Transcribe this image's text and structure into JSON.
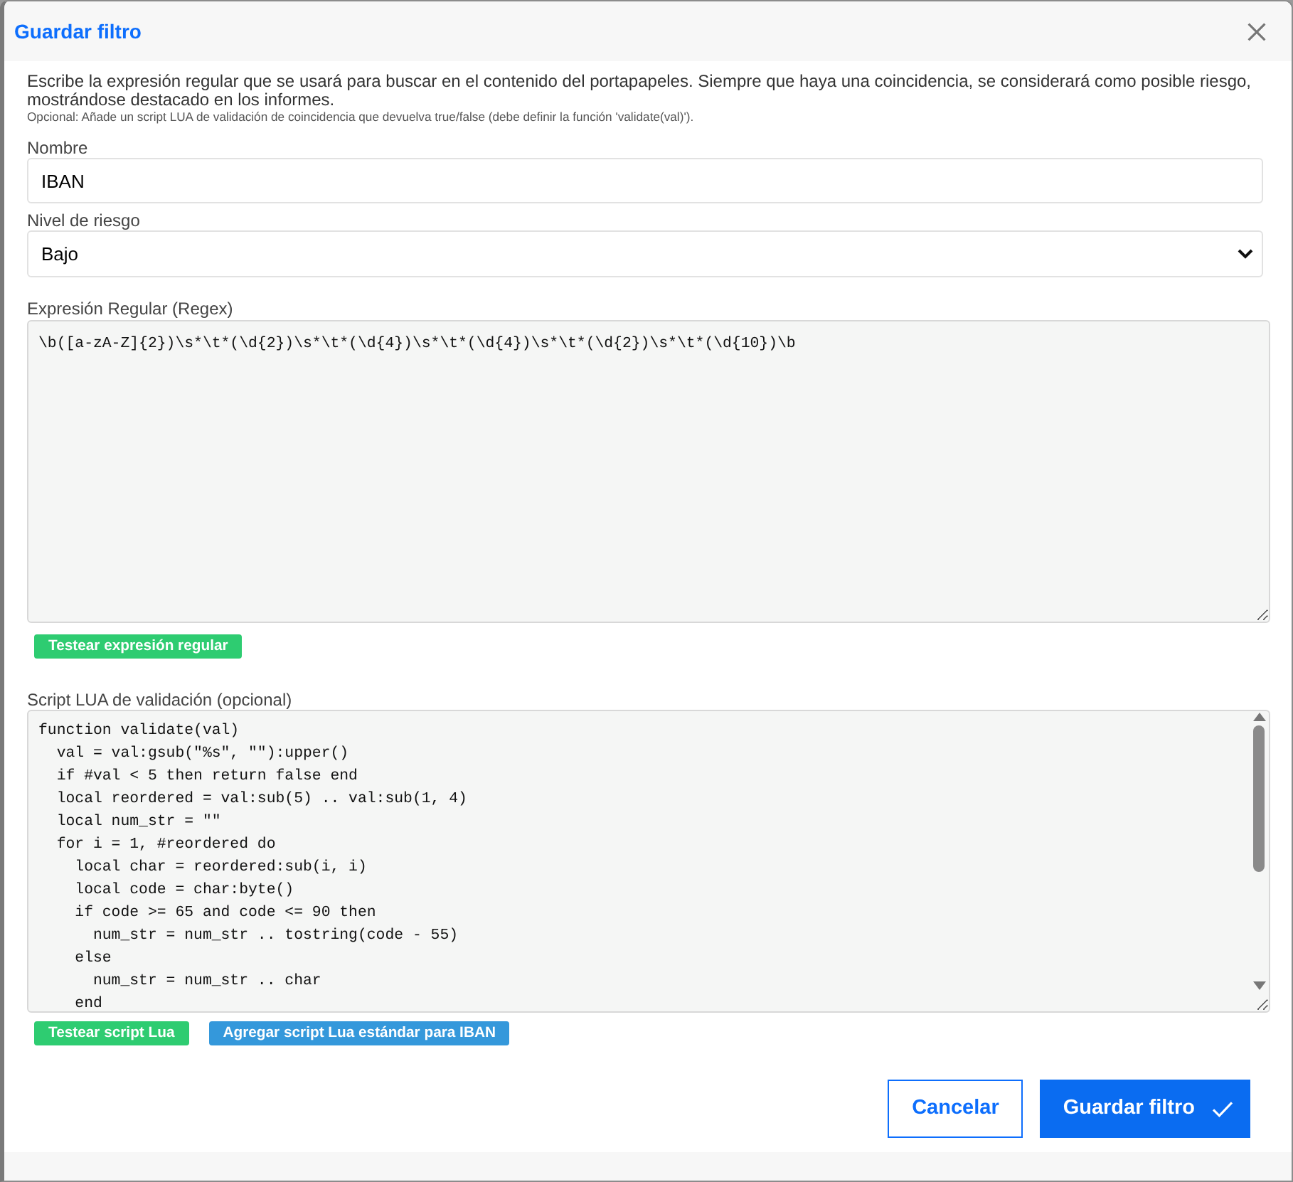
{
  "dialog": {
    "title": "Guardar filtro"
  },
  "intro": {
    "description": "Escribe la expresión regular que se usará para buscar en el contenido del portapapeles. Siempre que haya una coincidencia, se considerará como posible riesgo, mostrándose destacado en los informes.",
    "note": "Opcional: Añade un script LUA de validación de coincidencia que devuelva true/false (debe definir la función 'validate(val)')."
  },
  "fields": [
    {
      "kind": "text",
      "label": "Nombre",
      "value": "IBAN"
    },
    {
      "kind": "select",
      "label": "Nivel de riesgo",
      "value": "Bajo"
    },
    {
      "kind": "code",
      "label": "Expresión Regular (Regex)",
      "scrollable": false,
      "lines": [
        "\\b([a-zA-Z]{2})\\s*\\t*(\\d{2})\\s*\\t*(\\d{4})\\s*\\t*(\\d{4})\\s*\\t*(\\d{2})\\s*\\t*(\\d{10})\\b"
      ],
      "buttons": [
        {
          "label": "Testear expresión regular",
          "kind": "success"
        }
      ]
    },
    {
      "kind": "code",
      "label": "Script LUA de validación (opcional)",
      "scrollable": true,
      "lines": [
        "function validate(val)",
        "  val = val:gsub(\"%s\", \"\"):upper()",
        "  if #val < 5 then return false end",
        "  local reordered = val:sub(5) .. val:sub(1, 4)",
        "  local num_str = \"\"",
        "  for i = 1, #reordered do",
        "    local char = reordered:sub(i, i)",
        "    local code = char:byte()",
        "    if code >= 65 and code <= 90 then",
        "      num_str = num_str .. tostring(code - 55)",
        "    else",
        "      num_str = num_str .. char",
        "    end"
      ],
      "buttons": [
        {
          "label": "Testear script Lua",
          "kind": "success"
        },
        {
          "label": "Agregar script Lua estándar para IBAN",
          "kind": "info"
        }
      ]
    }
  ],
  "footer_buttons": [
    {
      "label": "Cancelar",
      "kind": "outline"
    },
    {
      "label": "Guardar filtro",
      "kind": "primary"
    }
  ]
}
